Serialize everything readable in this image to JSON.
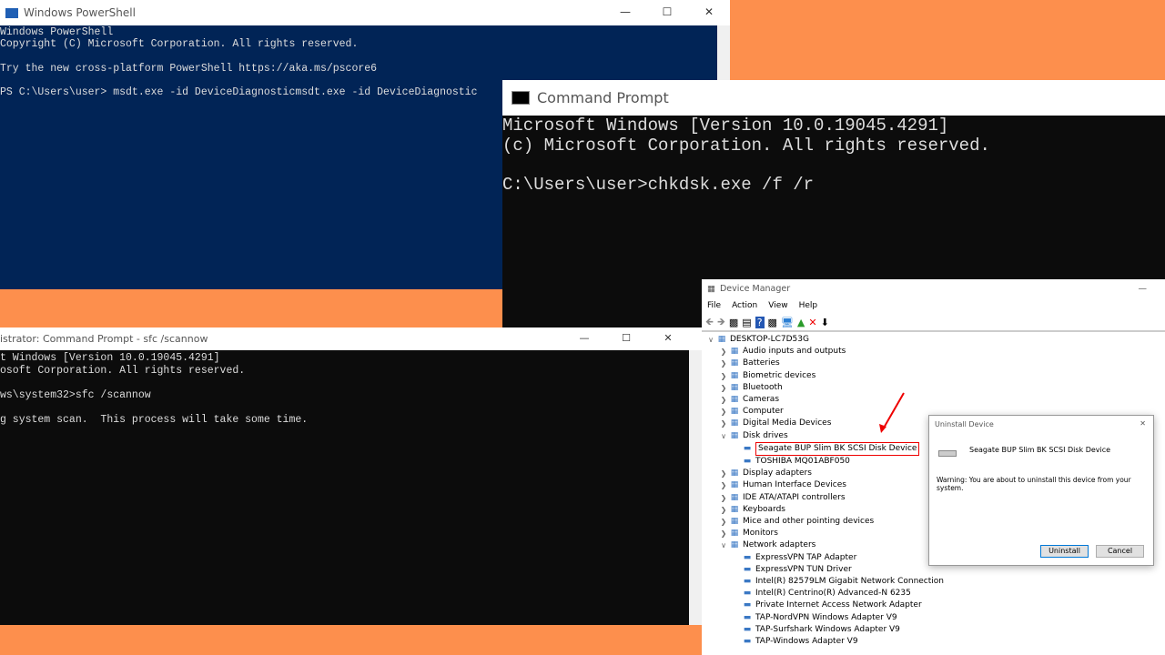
{
  "powershell": {
    "title": "Windows PowerShell",
    "lines": [
      "Windows PowerShell",
      "Copyright (C) Microsoft Corporation. All rights reserved.",
      "",
      "Try the new cross-platform PowerShell https://aka.ms/pscore6",
      "",
      "PS C:\\Users\\user> msdt.exe -id DeviceDiagnosticmsdt.exe -id DeviceDiagnostic"
    ]
  },
  "cmd": {
    "title": "Command Prompt",
    "lines": [
      "Microsoft Windows [Version 10.0.19045.4291]",
      "(c) Microsoft Corporation. All rights reserved.",
      "",
      "C:\\Users\\user>chkdsk.exe /f /r"
    ]
  },
  "admin_cmd": {
    "title": "istrator: Command Prompt - sfc  /scannow",
    "lines": [
      "t Windows [Version 10.0.19045.4291]",
      "osoft Corporation. All rights reserved.",
      "",
      "ws\\system32>sfc /scannow",
      "",
      "g system scan.  This process will take some time."
    ]
  },
  "device_manager": {
    "title": "Device Manager",
    "menu": [
      "File",
      "Action",
      "View",
      "Help"
    ],
    "root": "DESKTOP-LC7D53G",
    "categories": [
      {
        "label": "Audio inputs and outputs",
        "icon": "speaker"
      },
      {
        "label": "Batteries",
        "icon": "battery"
      },
      {
        "label": "Biometric devices",
        "icon": "fingerprint"
      },
      {
        "label": "Bluetooth",
        "icon": "bluetooth"
      },
      {
        "label": "Cameras",
        "icon": "camera"
      },
      {
        "label": "Computer",
        "icon": "monitor"
      },
      {
        "label": "Digital Media Devices",
        "icon": "media"
      },
      {
        "label": "Disk drives",
        "icon": "disk",
        "expanded": true,
        "children": [
          "Seagate BUP Slim BK SCSI Disk Device",
          "TOSHIBA MQ01ABF050"
        ]
      },
      {
        "label": "Display adapters",
        "icon": "display"
      },
      {
        "label": "Human Interface Devices",
        "icon": "hid"
      },
      {
        "label": "IDE ATA/ATAPI controllers",
        "icon": "ide"
      },
      {
        "label": "Keyboards",
        "icon": "keyboard"
      },
      {
        "label": "Mice and other pointing devices",
        "icon": "mouse"
      },
      {
        "label": "Monitors",
        "icon": "monitor"
      },
      {
        "label": "Network adapters",
        "icon": "network",
        "expanded": true,
        "children": [
          "ExpressVPN TAP Adapter",
          "ExpressVPN TUN Driver",
          "Intel(R) 82579LM Gigabit Network Connection",
          "Intel(R) Centrino(R) Advanced-N 6235",
          "Private Internet Access Network Adapter",
          "TAP-NordVPN Windows Adapter V9",
          "TAP-Surfshark Windows Adapter V9",
          "TAP-Windows Adapter V9"
        ]
      }
    ]
  },
  "dialog": {
    "title": "Uninstall Device",
    "device": "Seagate BUP Slim BK SCSI Disk Device",
    "warning": "Warning: You are about to uninstall this device from your system.",
    "uninstall": "Uninstall",
    "cancel": "Cancel"
  },
  "colors": {
    "background": "#fd8f4d",
    "powershell": "#012456",
    "highlight": "#e00000"
  }
}
